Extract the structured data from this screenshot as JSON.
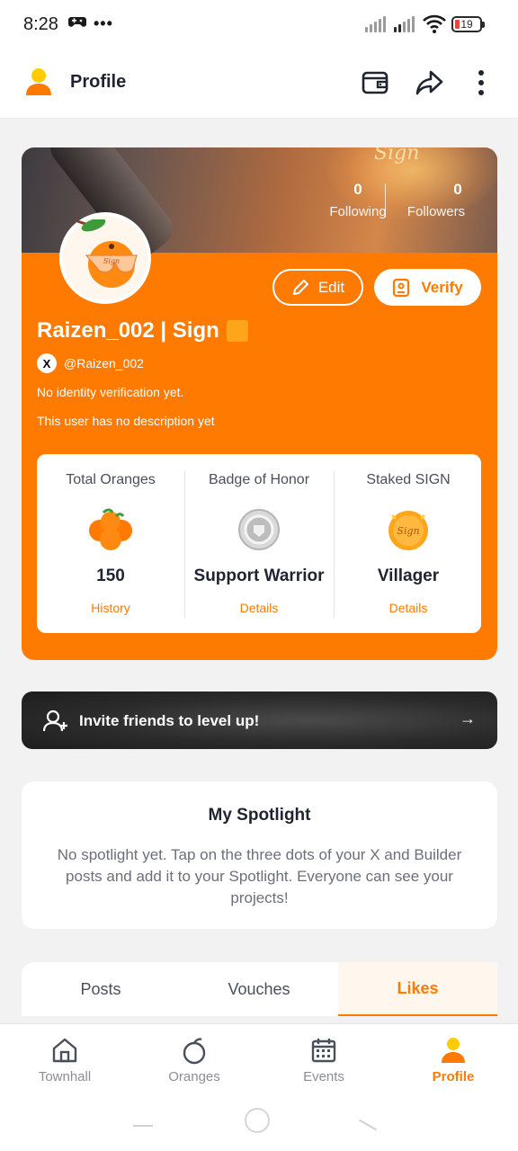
{
  "status": {
    "time": "8:28",
    "left_icons": [
      "gamepad-icon",
      "more-dots-icon"
    ],
    "battery": "19"
  },
  "header": {
    "title": "Profile",
    "actions": [
      "wallet-icon",
      "share-icon",
      "more-vertical-icon"
    ]
  },
  "profile": {
    "following_count": "0",
    "following_label": "Following",
    "followers_count": "0",
    "followers_label": "Followers",
    "name": "Raizen_002 | Sign",
    "handle": "@Raizen_002",
    "x_badge": "X",
    "verification_text": "No identity verification yet.",
    "description": "This user has no description yet",
    "edit_label": "Edit",
    "verify_label": "Verify",
    "avatar_text": "Sign",
    "banner_logo_text": "Sign"
  },
  "stats": [
    {
      "title": "Total Oranges",
      "value": "150",
      "link": "History",
      "icon": "oranges-icon"
    },
    {
      "title": "Badge of Honor",
      "value": "Support Warrior",
      "link": "Details",
      "icon": "silver-badge-icon"
    },
    {
      "title": "Staked SIGN",
      "value": "Villager",
      "link": "Details",
      "icon": "sign-coin-icon",
      "coin_text": "Sign"
    }
  ],
  "invite": {
    "label": "Invite friends to level up!",
    "arrow": "→"
  },
  "spotlight": {
    "title": "My Spotlight",
    "text": "No spotlight yet. Tap on the three dots of your X and Builder posts and add it to your Spotlight. Everyone can see your projects!"
  },
  "tabs": [
    {
      "label": "Posts",
      "active": false
    },
    {
      "label": "Vouches",
      "active": false
    },
    {
      "label": "Likes",
      "active": true
    }
  ],
  "nav": [
    {
      "label": "Townhall",
      "icon": "home-icon",
      "active": false
    },
    {
      "label": "Oranges",
      "icon": "orange-icon",
      "active": false
    },
    {
      "label": "Events",
      "icon": "calendar-icon",
      "active": false
    },
    {
      "label": "Profile",
      "icon": "profile-icon",
      "active": true
    }
  ],
  "colors": {
    "accent": "#ff7a00",
    "card_bg": "#ffffff",
    "page_bg": "#f2f2f2",
    "dark_banner": "#2b2b2b"
  }
}
